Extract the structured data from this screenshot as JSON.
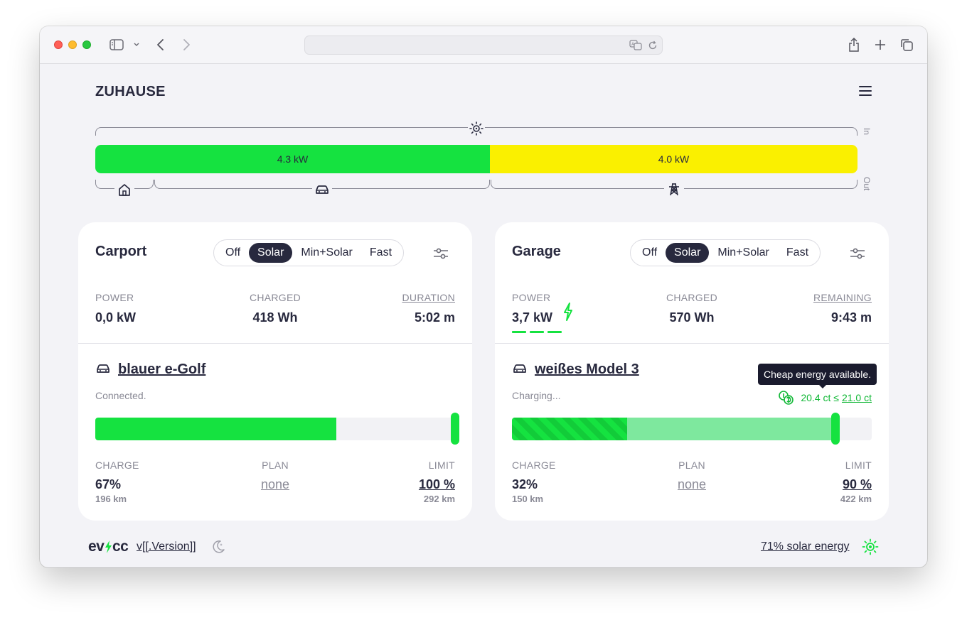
{
  "site": {
    "title": "ZUHAUSE"
  },
  "energyflow": {
    "pv_power": "4.3 kW",
    "grid_power": "4.0 kW",
    "in_label": "In",
    "out_label": "Out",
    "colors": {
      "solar": "#15e240",
      "grid": "#faf000"
    }
  },
  "loadpoints": [
    {
      "title": "Carport",
      "modes": [
        "Off",
        "Solar",
        "Min+Solar",
        "Fast"
      ],
      "active_mode": "Solar",
      "stats": [
        {
          "label": "POWER",
          "value": "0,0 kW"
        },
        {
          "label": "CHARGED",
          "value": "418 Wh"
        },
        {
          "label": "DURATION",
          "value": "5:02 m"
        }
      ],
      "vehicle": {
        "name": "blauer e-Golf",
        "status": "Connected."
      },
      "soc_fraction": 0.67,
      "limit_fraction": 1.0,
      "charge": {
        "label": "CHARGE",
        "value": "67%",
        "range": "196 km"
      },
      "plan": {
        "label": "PLAN",
        "value": "none"
      },
      "limit": {
        "label": "LIMIT",
        "value": "100 %",
        "range": "292 km"
      }
    },
    {
      "title": "Garage",
      "modes": [
        "Off",
        "Solar",
        "Min+Solar",
        "Fast"
      ],
      "active_mode": "Solar",
      "stats": [
        {
          "label": "POWER",
          "value": "3,7 kW"
        },
        {
          "label": "CHARGED",
          "value": "570 Wh"
        },
        {
          "label": "REMAINING",
          "value": "9:43 m"
        }
      ],
      "vehicle": {
        "name": "weißes Model 3",
        "status": "Charging..."
      },
      "tooltip": "Cheap energy available.",
      "tariff": {
        "price": "20.4 ct ≤",
        "limit": "21.0 ct"
      },
      "soc_fraction": 0.32,
      "limit_fraction": 0.9,
      "charge": {
        "label": "CHARGE",
        "value": "32%",
        "range": "150 km"
      },
      "plan": {
        "label": "PLAN",
        "value": "none"
      },
      "limit": {
        "label": "LIMIT",
        "value": "90 %",
        "range": "422 km"
      }
    }
  ],
  "footer": {
    "logo": "evcc",
    "version": "v[[.Version]]",
    "solar": "71% solar energy"
  }
}
